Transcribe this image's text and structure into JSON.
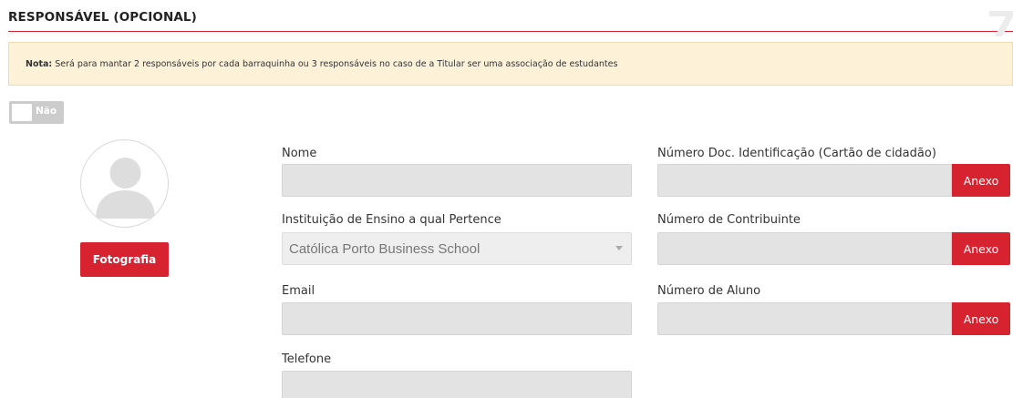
{
  "section": {
    "title": "RESPONSÁVEL (OPCIONAL)"
  },
  "note": {
    "label": "Nota:",
    "text": "Será para mantar 2 responsáveis por cada barraquinha ou 3 responsáveis no caso de a Titular ser uma associação de estudantes"
  },
  "toggle": {
    "label": "Não",
    "state": "off"
  },
  "photo": {
    "button_label": "Fotografia"
  },
  "fields": {
    "nome": {
      "label": "Nome",
      "value": ""
    },
    "instituicao": {
      "label": "Instituição de Ensino a qual Pertence",
      "value": "Católica Porto Business School"
    },
    "email": {
      "label": "Email",
      "value": ""
    },
    "telefone": {
      "label": "Telefone",
      "value": ""
    },
    "doc_identificacao": {
      "label": "Número Doc. Identificação (Cartão de cidadão)",
      "value": "",
      "button_label": "Anexo"
    },
    "contribuinte": {
      "label": "Número de Contribuinte",
      "value": "",
      "button_label": "Anexo"
    },
    "aluno": {
      "label": "Número de Aluno",
      "value": "",
      "button_label": "Anexo"
    }
  },
  "colors": {
    "accent": "#d6232f",
    "note_background": "#fdf1d8",
    "input_background": "#e3e3e3"
  }
}
